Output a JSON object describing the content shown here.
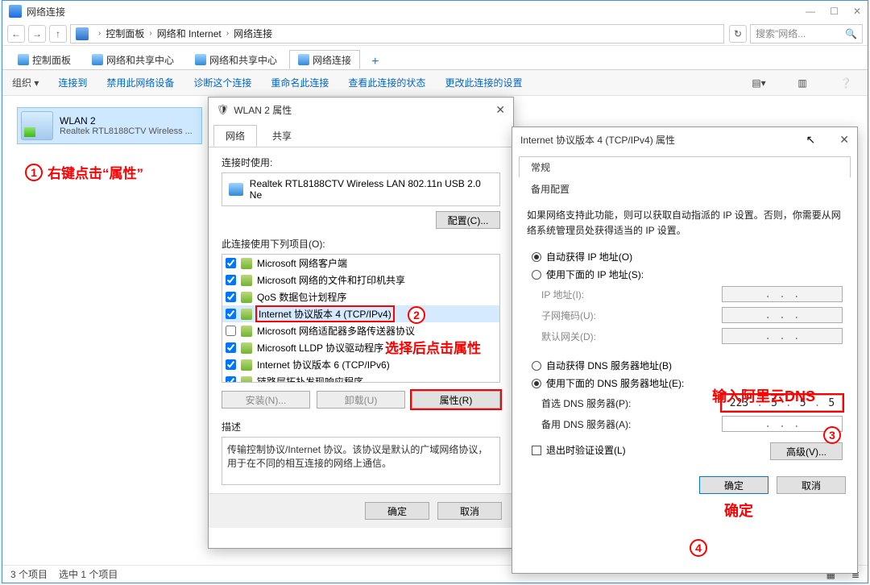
{
  "window": {
    "title": "网络连接",
    "breadcrumb": [
      "控制面板",
      "网络和 Internet",
      "网络连接"
    ],
    "search_placeholder": "搜索\"网络...",
    "tabs": [
      "控制面板",
      "网络和共享中心",
      "网络和共享中心",
      "网络连接"
    ],
    "commands": {
      "org": "组织 ▾",
      "c1": "连接到",
      "c2": "禁用此网络设备",
      "c3": "诊断这个连接",
      "c4": "重命名此连接",
      "c5": "查看此连接的状态",
      "c6": "更改此连接的设置"
    },
    "connection": {
      "name": "WLAN 2",
      "desc": "Realtek RTL8188CTV Wireless ..."
    },
    "status": {
      "items": "3 个项目",
      "sel": "选中 1 个项目"
    }
  },
  "annot": {
    "a1": "右键点击“属性”",
    "a2": "选择后点击属性",
    "a3": "输入阿里云DNS",
    "a4": "确定"
  },
  "props": {
    "title": "WLAN 2 属性",
    "tab_net": "网络",
    "tab_share": "共享",
    "conn_label": "连接时使用:",
    "adapter": "Realtek RTL8188CTV Wireless LAN 802.11n USB 2.0 Ne",
    "configure": "配置(C)...",
    "items_label": "此连接使用下列项目(O):",
    "items": [
      "Microsoft 网络客户端",
      "Microsoft 网络的文件和打印机共享",
      "QoS 数据包计划程序",
      "Internet 协议版本 4 (TCP/IPv4)",
      "Microsoft 网络适配器多路传送器协议",
      "Microsoft LLDP 协议驱动程序",
      "Internet 协议版本 6 (TCP/IPv6)",
      "链路层拓扑发现响应程序"
    ],
    "install": "安装(N)...",
    "uninstall": "卸载(U)",
    "propbtn": "属性(R)",
    "desc_label": "描述",
    "desc_text": "传输控制协议/Internet 协议。该协议是默认的广域网络协议，用于在不同的相互连接的网络上通信。",
    "ok": "确定",
    "cancel": "取消"
  },
  "ipv4": {
    "title": "Internet 协议版本 4 (TCP/IPv4) 属性",
    "tab_general": "常规",
    "tab_alt": "备用配置",
    "help": "如果网络支持此功能，则可以获取自动指派的 IP 设置。否则，你需要从网络系统管理员处获得适当的 IP 设置。",
    "r_auto_ip": "自动获得 IP 地址(O)",
    "r_manual_ip": "使用下面的 IP 地址(S):",
    "f_ip": "IP 地址(I):",
    "f_mask": "子网掩码(U):",
    "f_gw": "默认网关(D):",
    "r_auto_dns": "自动获得 DNS 服务器地址(B)",
    "r_manual_dns": "使用下面的 DNS 服务器地址(E):",
    "f_dns1": "首选 DNS 服务器(P):",
    "f_dns2": "备用 DNS 服务器(A):",
    "dns1": {
      "a": "223",
      "b": "5",
      "c": "5",
      "d": "5"
    },
    "chk_validate": "退出时验证设置(L)",
    "adv": "高级(V)...",
    "ok": "确定",
    "cancel": "取消"
  }
}
